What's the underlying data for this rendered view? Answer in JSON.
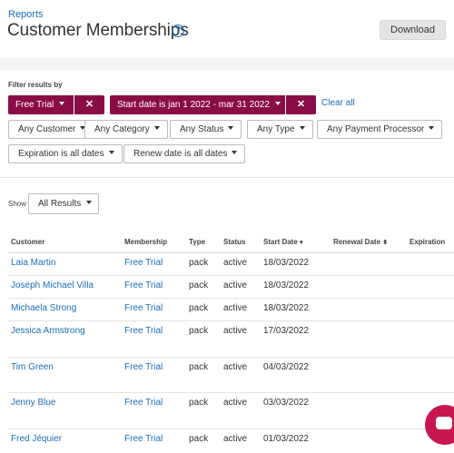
{
  "header": {
    "breadcrumb": "Reports",
    "title": "Customer Memberships",
    "help_icon": "question-circle-icon",
    "download_label": "Download"
  },
  "filters": {
    "label": "Filter results by",
    "active": [
      {
        "label": "Free Trial",
        "remove_icon": "close-icon"
      },
      {
        "label": "Start date is jan 1 2022 - mar 31 2022",
        "remove_icon": "close-icon"
      }
    ],
    "clear_all": "Clear all",
    "dropdowns": [
      "Any Customer",
      "Any Category",
      "Any Status",
      "Any Type",
      "Any Payment Processor",
      "Expiration is all dates",
      "Renew date is all dates"
    ]
  },
  "show": {
    "label": "Show",
    "value": "All Results"
  },
  "table": {
    "columns": [
      "Customer",
      "Membership",
      "Type",
      "Status",
      "Start Date",
      "Renewal Date",
      "Expiration"
    ],
    "sort_icons": {
      "start_date": "sort-desc-icon",
      "renewal_date": "sort-both-icon"
    },
    "rows": [
      {
        "customer": "Laia Martin",
        "membership": "Free Trial",
        "type": "pack",
        "status": "active",
        "start_date": "18/03/2022",
        "renewal_date": "",
        "expiration": ""
      },
      {
        "customer": "Joseph Michael Villa",
        "membership": "Free Trial",
        "type": "pack",
        "status": "active",
        "start_date": "18/03/2022",
        "renewal_date": "",
        "expiration": ""
      },
      {
        "customer": "Michaela Strong",
        "membership": "Free Trial",
        "type": "pack",
        "status": "active",
        "start_date": "18/03/2022",
        "renewal_date": "",
        "expiration": ""
      },
      {
        "customer": "Jessica Armstrong",
        "membership": "Free Trial",
        "type": "pack",
        "status": "active",
        "start_date": "17/03/2022",
        "renewal_date": "",
        "expiration": ""
      },
      {
        "customer": "Tim Green",
        "membership": "Free Trial",
        "type": "pack",
        "status": "active",
        "start_date": "04/03/2022",
        "renewal_date": "",
        "expiration": ""
      },
      {
        "customer": "Jenny Blue",
        "membership": "Free Trial",
        "type": "pack",
        "status": "active",
        "start_date": "03/03/2022",
        "renewal_date": "",
        "expiration": ""
      },
      {
        "customer": "Fred Jéquier",
        "membership": "Free Trial",
        "type": "pack",
        "status": "active",
        "start_date": "01/03/2022",
        "renewal_date": "",
        "expiration": ""
      }
    ]
  },
  "chat": {
    "icon": "chat-bubble-icon"
  },
  "colors": {
    "accent": "#8a0c47",
    "link": "#1a6fb5",
    "chat": "#c8174e"
  }
}
